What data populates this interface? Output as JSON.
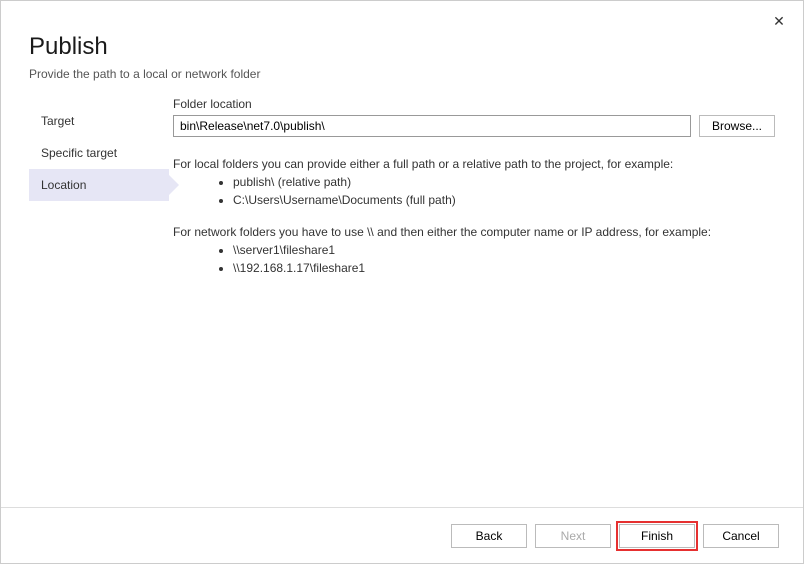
{
  "close_label": "✕",
  "header": {
    "title": "Publish",
    "subtitle": "Provide the path to a local or network folder"
  },
  "steps": {
    "target": "Target",
    "specific_target": "Specific target",
    "location": "Location"
  },
  "form": {
    "folder_label": "Folder location",
    "folder_value": "bin\\Release\\net7.0\\publish\\",
    "browse_label": "Browse..."
  },
  "help": {
    "local_intro": "For local folders you can provide either a full path or a relative path to the project, for example:",
    "local_ex1": "publish\\ (relative path)",
    "local_ex2": "C:\\Users\\Username\\Documents (full path)",
    "network_intro": "For network folders you have to use \\\\ and then either the computer name or IP address, for example:",
    "network_ex1": "\\\\server1\\fileshare1",
    "network_ex2": "\\\\192.168.1.17\\fileshare1"
  },
  "footer": {
    "back": "Back",
    "next": "Next",
    "finish": "Finish",
    "cancel": "Cancel"
  }
}
